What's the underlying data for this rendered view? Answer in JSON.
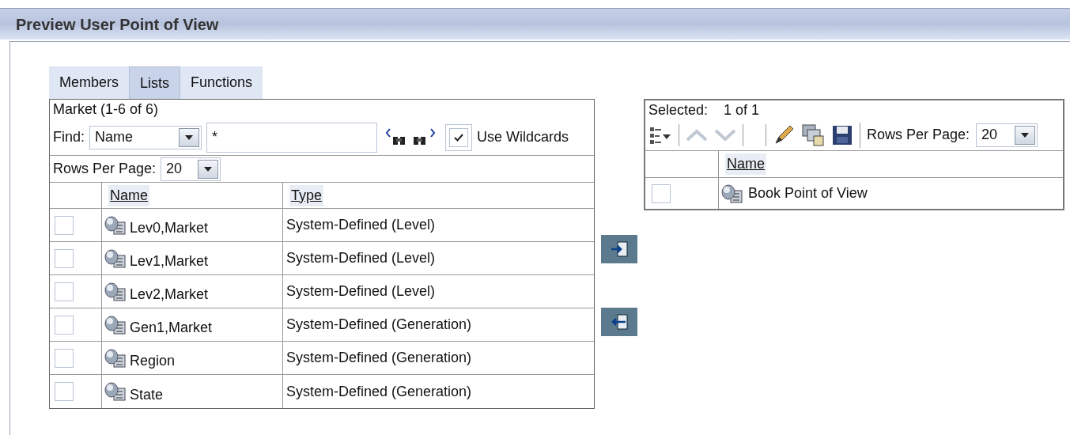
{
  "title": "Preview User Point of View",
  "tabs": [
    {
      "label": "Members",
      "selected": false
    },
    {
      "label": "Lists",
      "selected": true
    },
    {
      "label": "Functions",
      "selected": false
    }
  ],
  "list_panel": {
    "heading": "Market (1-6 of 6)",
    "find_label": "Find:",
    "find_by": "Name",
    "find_value": "*",
    "use_wildcards": {
      "label": "Use Wildcards",
      "checked": true
    },
    "rows_per_page": {
      "label": "Rows Per Page:",
      "value": "20"
    },
    "columns": [
      "Name",
      "Type"
    ],
    "rows": [
      {
        "checked": false,
        "name": "Lev0,Market",
        "type": "System-Defined (Level)"
      },
      {
        "checked": false,
        "name": "Lev1,Market",
        "type": "System-Defined (Level)"
      },
      {
        "checked": false,
        "name": "Lev2,Market",
        "type": "System-Defined (Level)"
      },
      {
        "checked": false,
        "name": "Gen1,Market",
        "type": "System-Defined (Generation)"
      },
      {
        "checked": false,
        "name": "Region",
        "type": "System-Defined (Generation)"
      },
      {
        "checked": false,
        "name": "State",
        "type": "System-Defined (Generation)"
      }
    ]
  },
  "selected_panel": {
    "selected_label": "Selected:",
    "selected_count": "1 of 1",
    "rows_per_page": {
      "label": "Rows Per Page:",
      "value": "20"
    },
    "columns": [
      "Name"
    ],
    "rows": [
      {
        "checked": false,
        "name": "Book Point of View"
      }
    ]
  }
}
